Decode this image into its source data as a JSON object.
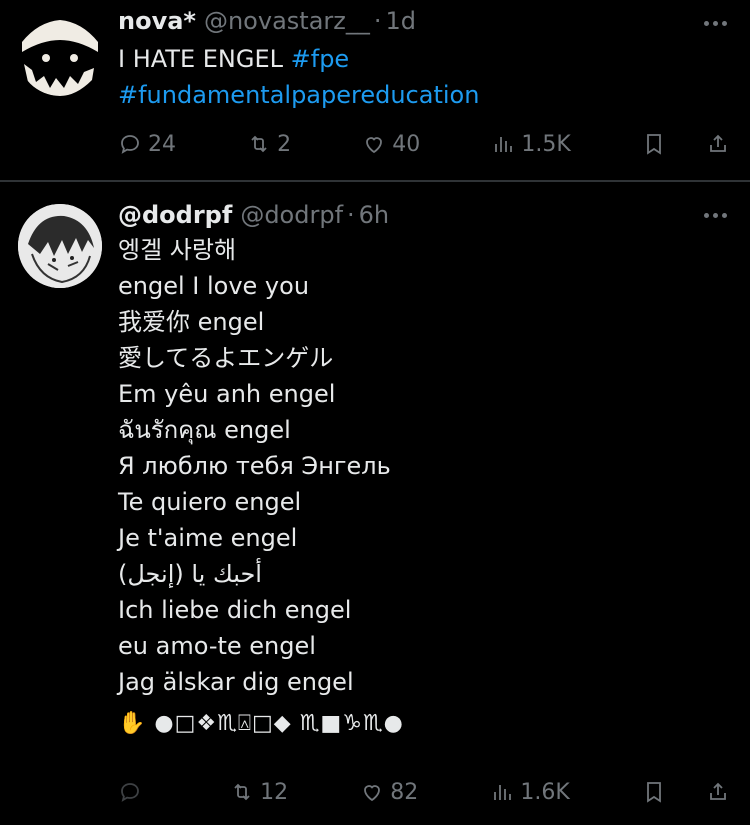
{
  "tweets": [
    {
      "display_name": "nova*",
      "handle": "@novastarz__",
      "time": "1d",
      "text_parts": [
        "I HATE ENGEL ",
        "#fpe",
        "#fundamentalpapereducation"
      ],
      "replies": "24",
      "reposts": "2",
      "likes": "40",
      "views": "1.5K"
    },
    {
      "display_name": "@dodrpf",
      "handle": "@dodrpf",
      "time": "6h",
      "lines": [
        "엥겔 사랑해",
        "engel I love you",
        "我爱你 engel",
        "愛してるよエンゲル",
        "Em yêu anh engel",
        "ฉันรักคุณ engel",
        "Я люблю тебя Энгель",
        "Te quiero engel",
        "Je t'aime engel",
        "أحبك يا (إنجل)",
        "Ich liebe dich engel",
        "eu amo-te engel",
        "Jag älskar dig engel"
      ],
      "emoji_line": "✋️ ●□❖♏︎⍓□◆ ♏︎■♑︎♏︎●",
      "replies": "",
      "reposts": "12",
      "likes": "82",
      "views": "1.6K"
    }
  ],
  "icons": {
    "reply": "reply-icon",
    "repost": "repost-icon",
    "like": "heart-icon",
    "views": "views-icon",
    "bookmark": "bookmark-icon",
    "share": "share-icon",
    "more": "more-icon"
  },
  "colors": {
    "background": "#000000",
    "text": "#e7e9ea",
    "muted": "#71767b",
    "link": "#1d9bf0",
    "divider": "#2f3336"
  }
}
